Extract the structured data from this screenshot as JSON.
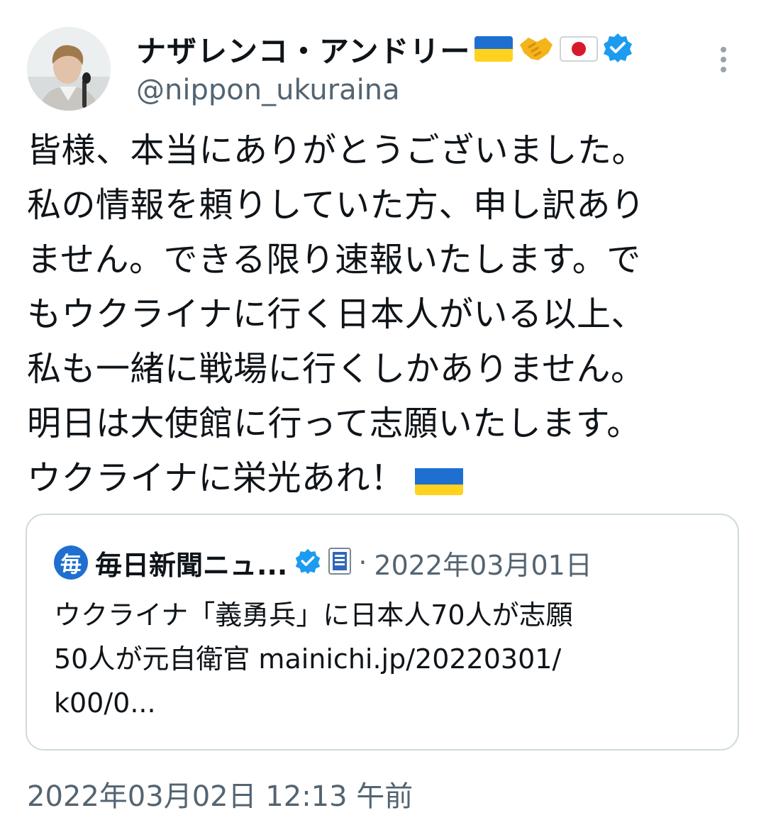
{
  "author": {
    "display_name": "ナザレンコ・アンドリー",
    "handle": "@nippon_ukuraina",
    "verified": true,
    "name_emoji": [
      "ukraine-flag-icon",
      "handshake-icon",
      "japan-flag-icon"
    ]
  },
  "tweet": {
    "lines": [
      "皆様、本当にありがとうございました。",
      "私の情報を頼りしていた方、申し訳あり",
      "ません。できる限り速報いたします。で",
      "もウクライナに行く日本人がいる以上、",
      "私も一緒に戦場に行くしかありません。",
      "明日は大使館に行って志願いたします。",
      "ウクライナに栄光あれ！"
    ],
    "timestamp": "2022年03月02日 12:13 午前"
  },
  "quoted_tweet": {
    "logo_char": "毎",
    "account_name": "毎日新聞ニュ...",
    "separator": "·",
    "date": "2022年03月01日",
    "lines": [
      "ウクライナ「義勇兵」に日本人70人が志願",
      "50人が元自衛官 mainichi.jp/20220301/",
      "k00/0..."
    ]
  },
  "colors": {
    "text": "#0f1419",
    "secondary": "#536471",
    "verified": "#1d9bf0",
    "ukraine_blue": "#1f6fd1",
    "ukraine_yellow": "#ffd21f",
    "japan_red": "#d7192c"
  }
}
